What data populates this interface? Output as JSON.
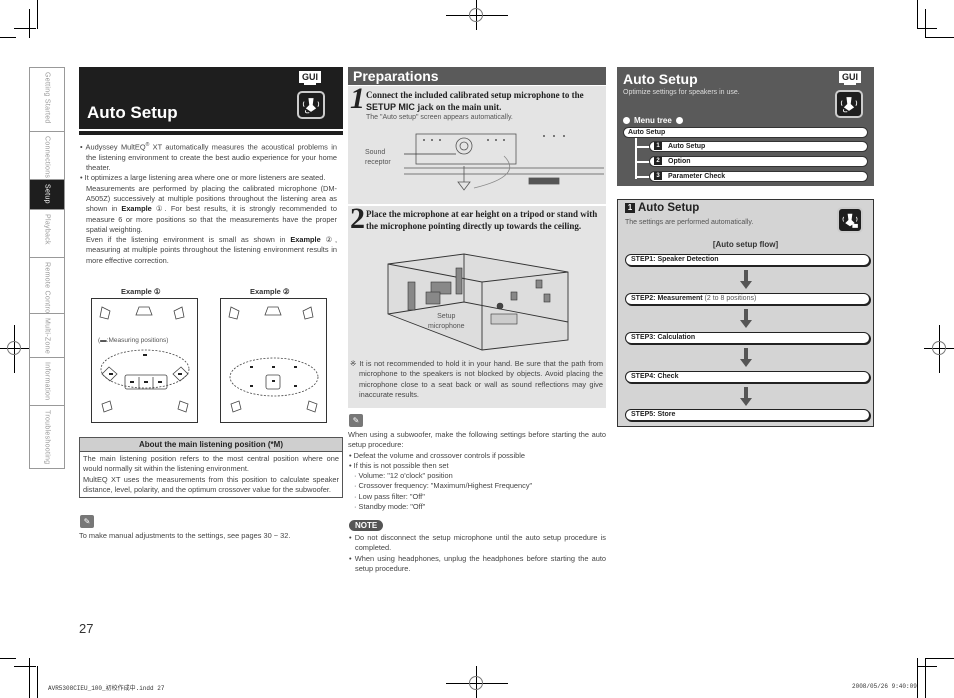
{
  "side_tabs": [
    {
      "label": "Getting Started",
      "active": false
    },
    {
      "label": "Connections",
      "active": false
    },
    {
      "label": "Setup",
      "active": true
    },
    {
      "label": "Playback",
      "active": false
    },
    {
      "label": "Remote Control",
      "active": false
    },
    {
      "label": "Multi-Zone",
      "active": false
    },
    {
      "label": "Information",
      "active": false
    },
    {
      "label": "Troubleshooting",
      "active": false
    }
  ],
  "left": {
    "title": "Auto Setup",
    "gui_badge": "GUI",
    "icon": "microphone-setup-icon",
    "bullets": [
      {
        "pre": "Audyssey MultEQ",
        "sup": "®",
        "post": " XT automatically measures the acoustical problems in the listening environment to create the best audio experience for your home theater."
      },
      {
        "text": "It optimizes a large listening area where one or more listeners are seated."
      }
    ],
    "para1": {
      "pre": "Measurements are performed by placing the calibrated microphone (DM-A505Z) successively at multiple positions throughout the listening area as shown in ",
      "bold": "Example",
      "num": " ①",
      "post": ". For best results, it is strongly recommended to measure 6 or more positions so that the measurements have the proper spatial weighting."
    },
    "para2": {
      "pre": "Even if the listening environment is small as shown in ",
      "bold": "Example",
      "num": " ②",
      "post": ", measuring at multiple points throughout the listening environment results in more effective correction."
    },
    "example1_label": "Example ①",
    "example2_label": "Example ②",
    "measuring_positions": "(▬:Measuring positions)",
    "seat_label": "*M",
    "about": {
      "title": "About the main listening position (*M)",
      "text1": "The main listening position refers to the most central position where one would normally sit within the listening environment.",
      "text2": "MultEQ XT uses the measurements from this position to calculate speaker distance, level, polarity, and the optimum crossover value for the subwoofer."
    },
    "memo_icon": "pencil-icon",
    "memo_text": "To make manual adjustments to the settings, see pages 30 ~ 32."
  },
  "middle": {
    "header": "Preparations",
    "step1": {
      "num": "1",
      "title_pre": "Connect the included calibrated setup microphone to the ",
      "title_bold": "SETUP MIC",
      "title_post": " jack on the main unit.",
      "sub": "The \"Auto setup\" screen appears automatically.",
      "callout1": "Sound",
      "callout2": "receptor"
    },
    "step2": {
      "num": "2",
      "title": "Place the microphone at ear height on a tripod or stand with the microphone pointing directly up towards the ceiling.",
      "callout1": "Setup",
      "callout2": "microphone",
      "note": "※ It is not recommended to hold it in your hand. Be sure that the path from microphone to the speakers is not blocked by objects. Avoid placing the microphone close to a seat back or wall as sound reflections may give inaccurate results."
    },
    "memo_text": "When using a subwoofer, make the following settings before starting the auto setup procedure:",
    "memo_bullets": [
      "Defeat the volume and crossover controls if possible",
      "If this is not possible then set"
    ],
    "memo_sub": [
      "Volume: \"12 o'clock\" position",
      "Crossover frequency: \"Maximum/Highest Frequency\"",
      "Low pass filter: \"Off\"",
      "Standby mode: \"Off\""
    ],
    "note_label": "NOTE",
    "notes": [
      "Do not disconnect the setup microphone until the auto setup procedure is completed.",
      "When using headphones, unplug the headphones before starting the auto setup procedure."
    ]
  },
  "right": {
    "title": "Auto Setup",
    "subtitle": "Optimize settings for speakers in use.",
    "gui_badge": "GUI",
    "menu_tree_label": "Menu tree",
    "root": "Auto Setup",
    "items": [
      {
        "num": "1",
        "label": "Auto Setup"
      },
      {
        "num": "2",
        "label": "Option"
      },
      {
        "num": "3",
        "label": "Parameter Check"
      }
    ],
    "flow": {
      "num": "1",
      "title": "Auto Setup",
      "subtitle": "The settings are performed automatically.",
      "head": "[Auto setup flow]",
      "steps": [
        {
          "label": "STEP1:  Speaker Detection",
          "extra": ""
        },
        {
          "label": "STEP2:  Measurement",
          "extra": " (2 to 8 positions)"
        },
        {
          "label": "STEP3:  Calculation",
          "extra": ""
        },
        {
          "label": "STEP4:  Check",
          "extra": ""
        },
        {
          "label": "STEP5:  Store",
          "extra": ""
        }
      ]
    }
  },
  "page_number": "27",
  "footer_left": "AVR5308CIEU_100_初校作成中.indd   27",
  "footer_right": "2008/05/26   9:40:09"
}
